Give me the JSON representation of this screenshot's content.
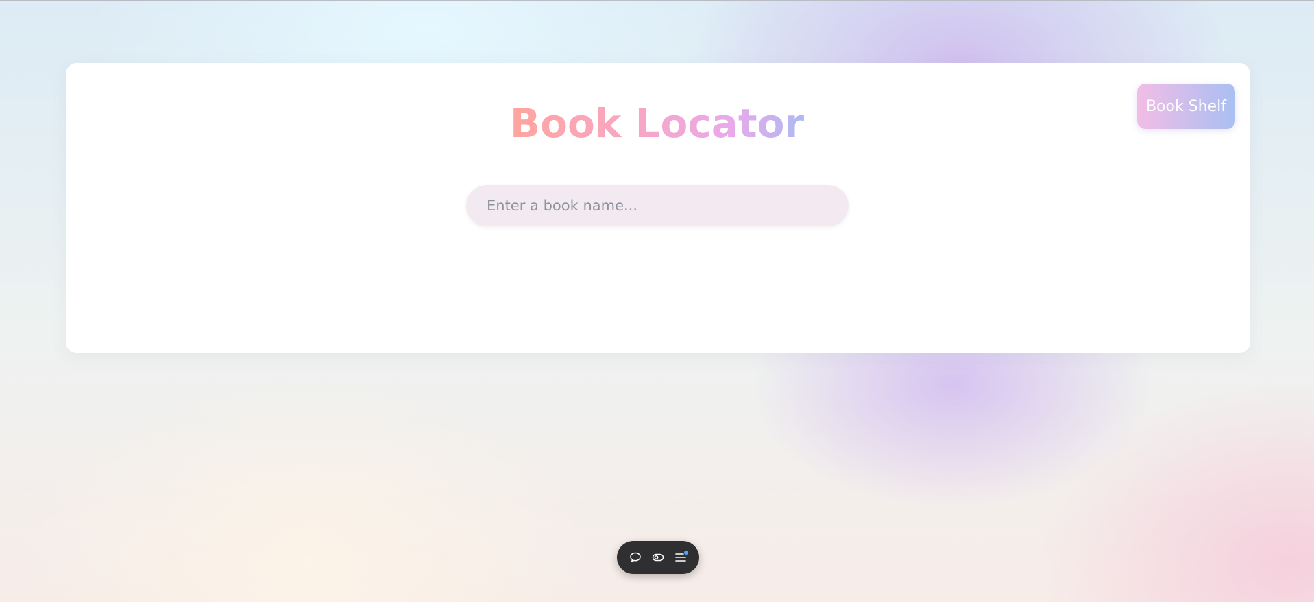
{
  "app": {
    "title": "Book Locator",
    "accent_gradient": [
      "#ffa59e",
      "#f7a6c8",
      "#e9a9ea",
      "#aebaf2"
    ]
  },
  "header": {
    "shelf_button_label": "Book Shelf"
  },
  "search": {
    "placeholder": "Enter a book name...",
    "value": ""
  },
  "toolbar": {
    "icons": [
      "chat-bubble-icon",
      "toggle-icon",
      "menu-icon"
    ],
    "notification_dot_color": "#4da3ff"
  }
}
